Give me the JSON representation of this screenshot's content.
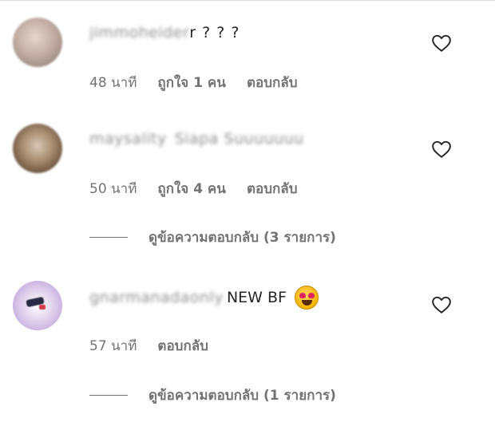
{
  "comments": [
    {
      "username": "jimmoheider",
      "text": "r ? ? ?",
      "time": "48 นาที",
      "likes": "ถูกใจ 1 คน",
      "reply": "ตอบกลับ",
      "icon": "heart-icon"
    },
    {
      "username": "maysality",
      "text": "Siapa Suuuuuuu",
      "time": "50 นาที",
      "likes": "ถูกใจ 4 คน",
      "reply": "ตอบกลับ",
      "view_replies": "ดูข้อความตอบกลับ (3 รายการ)",
      "icon": "heart-icon"
    },
    {
      "username": "gnarmanadaonly",
      "text": "NEW BF",
      "emoji": "heart-eyes-emoji",
      "time": "57 นาที",
      "reply": "ตอบกลับ",
      "view_replies": "ดูข้อความตอบกลับ (1 รายการ)",
      "icon": "heart-icon"
    }
  ]
}
